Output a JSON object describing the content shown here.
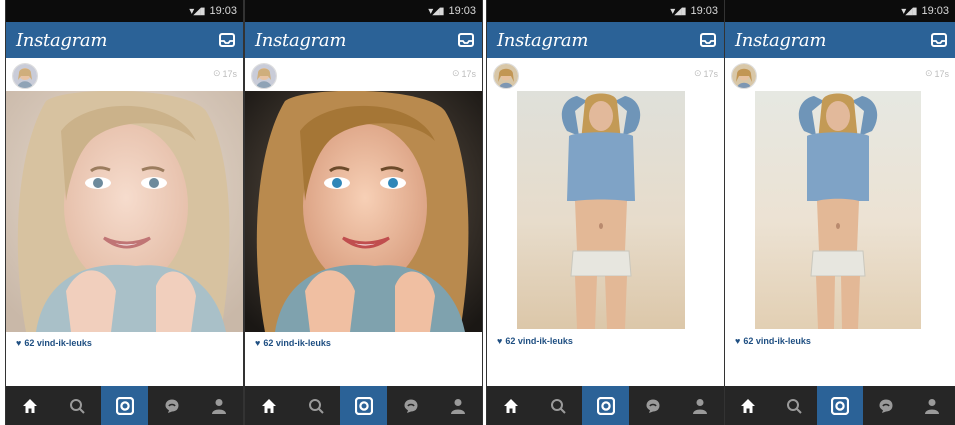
{
  "screens": [
    {
      "status_time": "19:03",
      "app_title": "Instagram",
      "post_time": "17s",
      "likes_text": "62 vind-ik-leuks",
      "photo": "selfie-original"
    },
    {
      "status_time": "19:03",
      "app_title": "Instagram",
      "post_time": "17s",
      "likes_text": "62 vind-ik-leuks",
      "photo": "selfie-edited"
    },
    {
      "status_time": "19:03",
      "app_title": "Instagram",
      "post_time": "17s",
      "likes_text": "62 vind-ik-leuks",
      "photo": "beach-original"
    },
    {
      "status_time": "19:03",
      "app_title": "Instagram",
      "post_time": "17s",
      "likes_text": "62 vind-ik-leuks",
      "photo": "beach-edited"
    }
  ],
  "nav_items": [
    "home-icon",
    "search-icon",
    "camera-icon",
    "activity-icon",
    "profile-icon"
  ],
  "colors": {
    "brand_blue": "#2b6297",
    "nav_dark": "#262626",
    "status_black": "#0c0c0c",
    "likes_blue": "#1f4f82"
  }
}
